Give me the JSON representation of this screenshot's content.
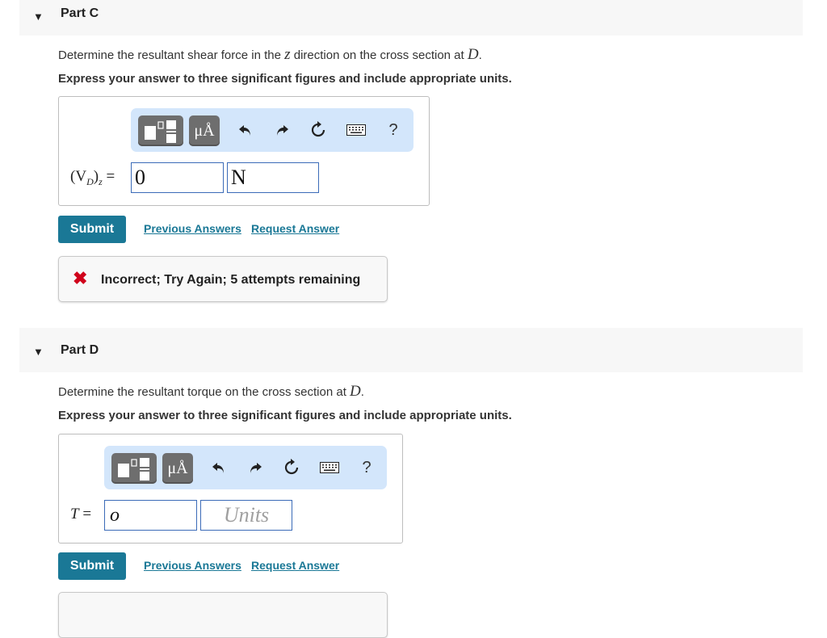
{
  "parts": [
    {
      "title": "Part C",
      "prompt_before": "Determine the resultant shear force in the ",
      "prompt_var": "z",
      "prompt_mid": " direction on the cross section at ",
      "prompt_point": "D",
      "prompt_end": ".",
      "instruction": "Express your answer to three significant figures and include appropriate units.",
      "label_main": "(V",
      "label_sub": "D",
      "label_close": ")",
      "label_sub2": "z",
      "label_eq": " =",
      "value": "0",
      "units": "N",
      "units_is_placeholder": false,
      "submit_label": "Submit",
      "previous_answers_label": "Previous Answers",
      "request_answer_label": "Request Answer",
      "feedback": "Incorrect; Try Again; 5 attempts remaining"
    },
    {
      "title": "Part D",
      "prompt_before": "Determine the resultant torque on the cross section at ",
      "prompt_point": "D",
      "prompt_end": ".",
      "instruction": "Express your answer to three significant figures and include appropriate units.",
      "label_var": "T",
      "label_eq": " =",
      "value": "o",
      "units": "Units",
      "units_is_placeholder": true,
      "submit_label": "Submit",
      "previous_answers_label": "Previous Answers",
      "request_answer_label": "Request Answer"
    }
  ],
  "toolbar": {
    "templates_icon": "fraction-template-icon",
    "units_label": "μÅ",
    "undo_icon": "undo-icon",
    "redo_icon": "redo-icon",
    "reset_icon": "reset-icon",
    "keyboard_icon": "keyboard-icon",
    "help_label": "?"
  },
  "colors": {
    "accent": "#1a7896",
    "error": "#d0021b",
    "toolbar_bg": "#d3e6fb",
    "input_border": "#3b6bb8"
  }
}
